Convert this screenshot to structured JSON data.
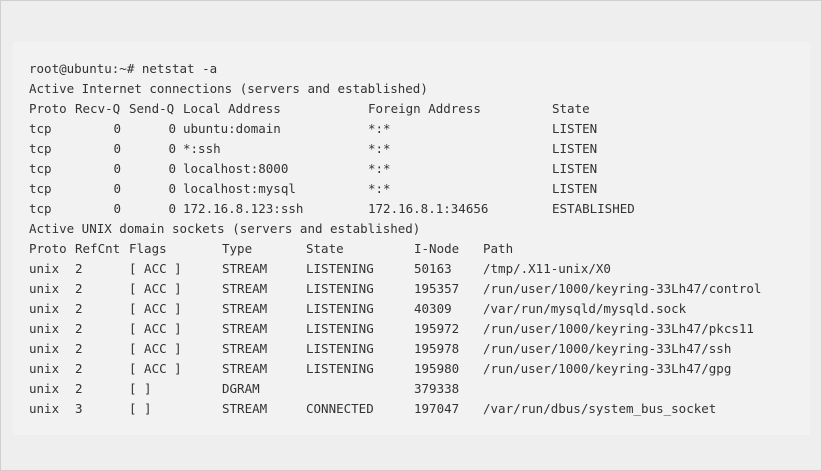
{
  "terminal": {
    "prompt_line": "root@ubuntu:~# netstat -a",
    "inet_header": "Active Internet connections (servers and established)",
    "inet_columns": {
      "proto": "Proto",
      "recvq": "Recv-Q",
      "sendq": "Send-Q",
      "local": "Local Address",
      "foreign": "Foreign Address",
      "state": "State"
    },
    "inet_rows": [
      {
        "proto": "tcp",
        "recvq": "0",
        "sendq": "0",
        "local": "ubuntu:domain",
        "foreign": "*:*",
        "state": "LISTEN"
      },
      {
        "proto": "tcp",
        "recvq": "0",
        "sendq": "0",
        "local": "*:ssh",
        "foreign": "*:*",
        "state": "LISTEN"
      },
      {
        "proto": "tcp",
        "recvq": "0",
        "sendq": "0",
        "local": "localhost:8000",
        "foreign": "*:*",
        "state": "LISTEN"
      },
      {
        "proto": "tcp",
        "recvq": "0",
        "sendq": "0",
        "local": "localhost:mysql",
        "foreign": "*:*",
        "state": "LISTEN"
      },
      {
        "proto": "tcp",
        "recvq": "0",
        "sendq": "0",
        "local": "172.16.8.123:ssh",
        "foreign": "172.16.8.1:34656",
        "state": "ESTABLISHED"
      }
    ],
    "unix_header": "Active UNIX domain sockets (servers and established)",
    "unix_columns": {
      "proto": "Proto",
      "refcnt": "RefCnt",
      "flags": "Flags",
      "type": "Type",
      "state": "State",
      "inode": "I-Node",
      "path": "Path"
    },
    "unix_rows": [
      {
        "proto": "unix",
        "refcnt": "2",
        "flags": "[ ACC ]",
        "type": "STREAM",
        "state": "LISTENING",
        "inode": "50163",
        "path": "/tmp/.X11-unix/X0"
      },
      {
        "proto": "unix",
        "refcnt": "2",
        "flags": "[ ACC ]",
        "type": "STREAM",
        "state": "LISTENING",
        "inode": "195357",
        "path": "/run/user/1000/keyring-33Lh47/control"
      },
      {
        "proto": "unix",
        "refcnt": "2",
        "flags": "[ ACC ]",
        "type": "STREAM",
        "state": "LISTENING",
        "inode": "40309",
        "path": "/var/run/mysqld/mysqld.sock"
      },
      {
        "proto": "unix",
        "refcnt": "2",
        "flags": "[ ACC ]",
        "type": "STREAM",
        "state": "LISTENING",
        "inode": "195972",
        "path": "/run/user/1000/keyring-33Lh47/pkcs11"
      },
      {
        "proto": "unix",
        "refcnt": "2",
        "flags": "[ ACC ]",
        "type": "STREAM",
        "state": "LISTENING",
        "inode": "195978",
        "path": "/run/user/1000/keyring-33Lh47/ssh"
      },
      {
        "proto": "unix",
        "refcnt": "2",
        "flags": "[ ACC ]",
        "type": "STREAM",
        "state": "LISTENING",
        "inode": "195980",
        "path": "/run/user/1000/keyring-33Lh47/gpg"
      },
      {
        "proto": "unix",
        "refcnt": "2",
        "flags": "[ ]",
        "type": "DGRAM",
        "state": "",
        "inode": "379338",
        "path": ""
      },
      {
        "proto": "unix",
        "refcnt": "3",
        "flags": "[ ]",
        "type": "STREAM",
        "state": "CONNECTED",
        "inode": "197047",
        "path": "/var/run/dbus/system_bus_socket"
      }
    ]
  }
}
